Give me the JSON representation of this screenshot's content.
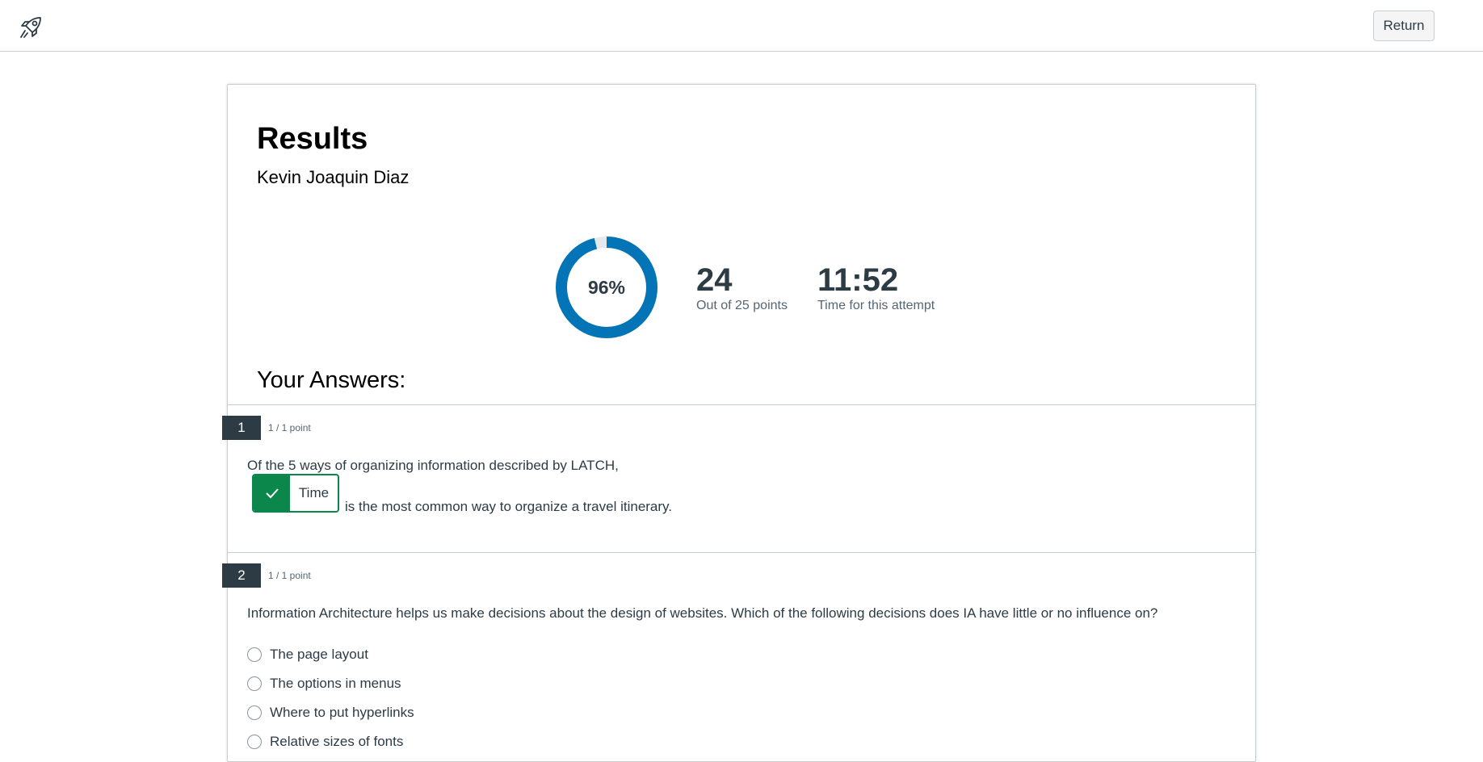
{
  "header": {
    "logo_icon": "rocket-icon",
    "return_label": "Return"
  },
  "results": {
    "title": "Results",
    "student_name": "Kevin Joaquin Diaz",
    "score_percent": 96,
    "score_percent_label": "96%",
    "points": "24",
    "points_caption": "Out of 25 points",
    "time": "11:52",
    "time_caption": "Time for this attempt",
    "accent_color": "#0374b5"
  },
  "answers": {
    "heading": "Your Answers:",
    "questions": [
      {
        "number": "1",
        "points": "1 / 1 point",
        "text_before": "Of the 5 ways of organizing information described by LATCH,",
        "answer": "Time",
        "answer_status": "correct",
        "text_after": "is the most common way to organize a travel itinerary."
      },
      {
        "number": "2",
        "points": "1 / 1 point",
        "text": "Information Architecture helps us make decisions about the design of websites. Which of the following decisions does IA have little or no influence on?",
        "options": [
          "The page layout",
          "The options in menus",
          "Where to put hyperlinks",
          "Relative sizes of fonts"
        ]
      }
    ]
  },
  "colors": {
    "correct": "#0b874b",
    "badge": "#2d3b45"
  }
}
